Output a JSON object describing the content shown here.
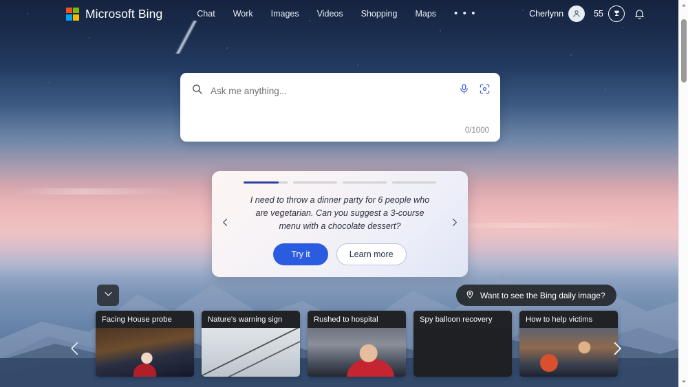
{
  "brand": {
    "name": "Microsoft Bing",
    "logo_colors": [
      "#f25022",
      "#7fba00",
      "#00a4ef",
      "#ffb900"
    ]
  },
  "nav": {
    "items": [
      {
        "label": "Chat"
      },
      {
        "label": "Work"
      },
      {
        "label": "Images"
      },
      {
        "label": "Videos"
      },
      {
        "label": "Shopping"
      },
      {
        "label": "Maps"
      }
    ],
    "more_label": "• • •"
  },
  "account": {
    "user_name": "Cherlynn",
    "avatar_icon": "person-icon",
    "rewards_count": "55",
    "rewards_icon": "rewards-trophy-icon",
    "notifications_icon": "bell-icon",
    "menu_icon": "hamburger-menu-icon"
  },
  "search": {
    "placeholder": "Ask me anything...",
    "value": "",
    "char_count": "0/1000",
    "search_icon": "search-icon",
    "mic_icon": "microphone-icon",
    "visual_search_icon": "camera-visual-search-icon",
    "accent_color": "#2b5ce0"
  },
  "suggestion": {
    "text": "I need to throw a dinner party for 6 people who are vegetarian. Can you suggest a 3-course menu with a chocolate dessert?",
    "try_label": "Try it",
    "learn_label": "Learn more",
    "prev_icon": "chevron-left-icon",
    "next_icon": "chevron-right-icon",
    "progress": {
      "total": 4,
      "active_index": 0,
      "active_fill_percent": 80,
      "active_color": "#2b3fa0",
      "inactive_color": "#d2d2d6"
    }
  },
  "daily_image": {
    "label": "Want to see the Bing daily image?",
    "icon": "location-pin-icon"
  },
  "collapse_toggle": {
    "icon": "chevron-down-icon"
  },
  "news": {
    "prev_icon": "chevron-left-icon",
    "next_icon": "chevron-right-icon",
    "cards": [
      {
        "title": "Facing House probe"
      },
      {
        "title": "Nature's warning sign"
      },
      {
        "title": "Rushed to hospital"
      },
      {
        "title": "Spy balloon recovery"
      },
      {
        "title": "How to help victims"
      }
    ]
  },
  "scrollbar": {
    "up_icon": "scroll-up-arrow-icon",
    "down_icon": "scroll-down-arrow-icon"
  }
}
